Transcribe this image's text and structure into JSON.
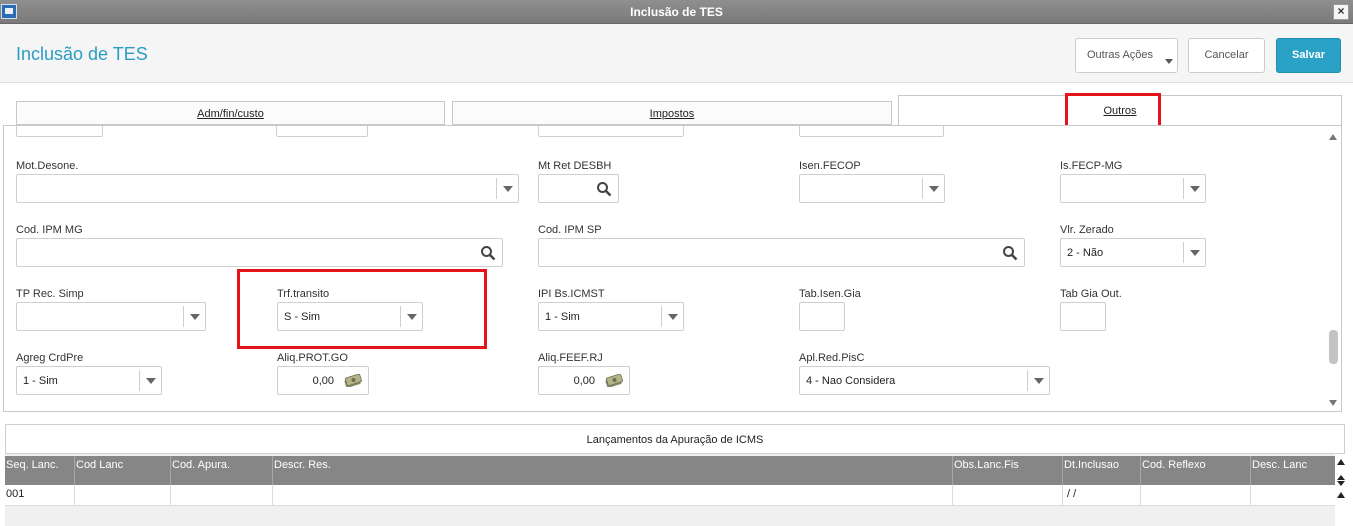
{
  "window": {
    "title": "Inclusão de TES",
    "close_glyph": "×"
  },
  "header": {
    "page_title": "Inclusão de TES",
    "buttons": {
      "other_actions": "Outras Ações",
      "cancel": "Cancelar",
      "save": "Salvar"
    }
  },
  "tabs": [
    {
      "label": "Adm/fin/custo",
      "active": false
    },
    {
      "label": "Impostos",
      "active": false
    },
    {
      "label": "Outros",
      "active": true
    }
  ],
  "fields": {
    "mot_desone": {
      "label": "Mot.Desone.",
      "value": ""
    },
    "mt_ret_desbh": {
      "label": "Mt Ret DESBH",
      "value": ""
    },
    "isen_fecop": {
      "label": "Isen.FECOP",
      "value": ""
    },
    "is_fecp_mg": {
      "label": "Is.FECP-MG",
      "value": ""
    },
    "cod_ipm_mg": {
      "label": "Cod. IPM MG",
      "value": ""
    },
    "cod_ipm_sp": {
      "label": "Cod. IPM SP",
      "value": ""
    },
    "vlr_zerado": {
      "label": "Vlr. Zerado",
      "value": "2 - Não"
    },
    "tp_rec_simp": {
      "label": "TP Rec. Simp",
      "value": ""
    },
    "trf_transito": {
      "label": "Trf.transito",
      "value": "S - Sim"
    },
    "ipi_bs_icmst": {
      "label": "IPI Bs.ICMST",
      "value": "1 - Sim"
    },
    "tab_isen_gia": {
      "label": "Tab.Isen.Gia",
      "value": ""
    },
    "tab_gia_out": {
      "label": "Tab Gia Out.",
      "value": ""
    },
    "agreg_crdpre": {
      "label": "Agreg CrdPre",
      "value": "1 - Sim"
    },
    "aliq_prot_go": {
      "label": "Aliq.PROT.GO",
      "value": "0,00"
    },
    "aliq_feef_rj": {
      "label": "Aliq.FEEF.RJ",
      "value": "0,00"
    },
    "apl_red_pisc": {
      "label": "Apl.Red.PisC",
      "value": "4 - Nao Considera"
    }
  },
  "grid": {
    "title": "Lançamentos da Apuração de ICMS",
    "columns": [
      "Seq. Lanc.",
      "Cod Lanc",
      "Cod. Apura.",
      "Descr. Res.",
      "Obs.Lanc.Fis",
      "Dt.Inclusao",
      "Cod. Reflexo",
      "Desc. Lanc"
    ],
    "rows": [
      [
        "001",
        "",
        "",
        "",
        "",
        " / /",
        "",
        ""
      ]
    ]
  },
  "colors": {
    "accent": "#2aa2c6",
    "highlight": "#e3151a",
    "title_text": "#2a9dc2"
  },
  "icons": {
    "search": "search-icon",
    "money": "money-icon",
    "dropdown": "chevron-down-icon"
  }
}
